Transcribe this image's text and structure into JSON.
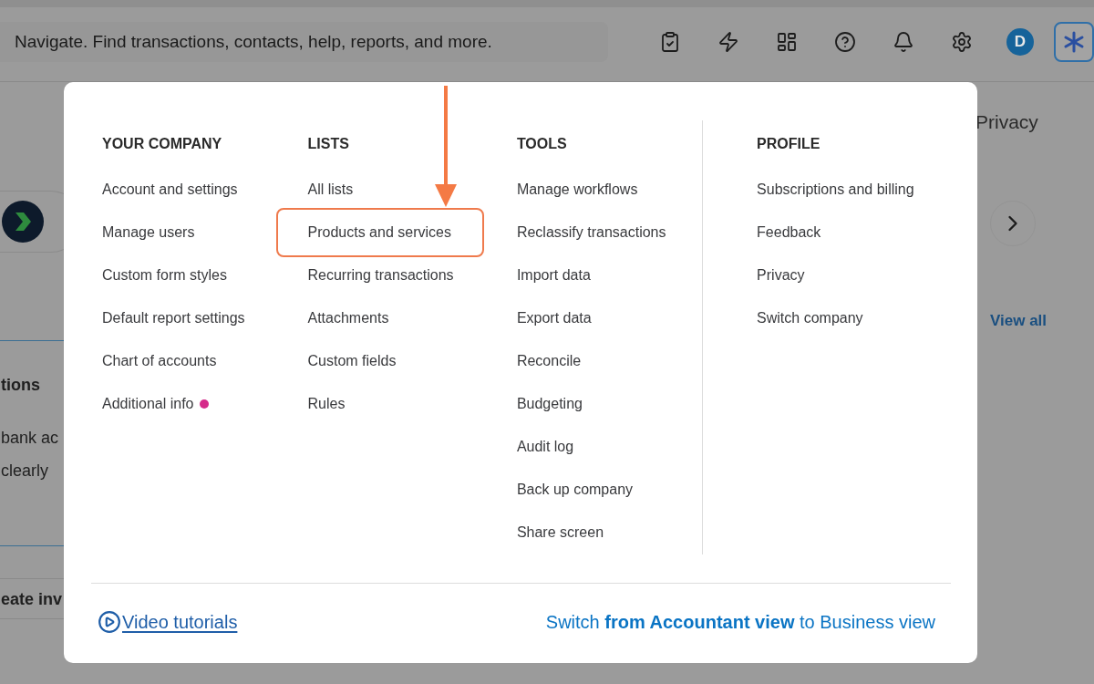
{
  "search": {
    "placeholder": "Navigate. Find transactions, contacts, help, reports, and more."
  },
  "toolbar": {
    "avatar": "D"
  },
  "background": {
    "privacy": "Privacy",
    "view_all": "View all",
    "fragments": [
      {
        "text": "tions",
        "kind": "heading"
      },
      {
        "text": "bank ac",
        "kind": "body"
      },
      {
        "text": "clearly",
        "kind": "body"
      },
      {
        "text": "eate inv",
        "kind": "action"
      }
    ]
  },
  "menu": {
    "columns": [
      {
        "heading": "YOUR COMPANY",
        "items": [
          {
            "label": "Account and settings",
            "highlighted": false,
            "dot": false
          },
          {
            "label": "Manage users",
            "highlighted": false,
            "dot": false
          },
          {
            "label": "Custom form styles",
            "highlighted": false,
            "dot": false
          },
          {
            "label": "Default report settings",
            "highlighted": false,
            "dot": false
          },
          {
            "label": "Chart of accounts",
            "highlighted": false,
            "dot": false
          },
          {
            "label": "Additional info",
            "highlighted": false,
            "dot": true
          }
        ]
      },
      {
        "heading": "LISTS",
        "items": [
          {
            "label": "All lists",
            "highlighted": false,
            "dot": false
          },
          {
            "label": "Products and services",
            "highlighted": true,
            "dot": false
          },
          {
            "label": "Recurring transactions",
            "highlighted": false,
            "dot": false
          },
          {
            "label": "Attachments",
            "highlighted": false,
            "dot": false
          },
          {
            "label": "Custom fields",
            "highlighted": false,
            "dot": false
          },
          {
            "label": "Rules",
            "highlighted": false,
            "dot": false
          }
        ]
      },
      {
        "heading": "TOOLS",
        "items": [
          {
            "label": "Manage workflows",
            "highlighted": false,
            "dot": false
          },
          {
            "label": "Reclassify transactions",
            "highlighted": false,
            "dot": false
          },
          {
            "label": "Import data",
            "highlighted": false,
            "dot": false
          },
          {
            "label": "Export data",
            "highlighted": false,
            "dot": false
          },
          {
            "label": "Reconcile",
            "highlighted": false,
            "dot": false
          },
          {
            "label": "Budgeting",
            "highlighted": false,
            "dot": false
          },
          {
            "label": "Audit log",
            "highlighted": false,
            "dot": false
          },
          {
            "label": "Back up company",
            "highlighted": false,
            "dot": false
          },
          {
            "label": "Share screen",
            "highlighted": false,
            "dot": false
          }
        ]
      },
      {
        "heading": "PROFILE",
        "items": [
          {
            "label": "Subscriptions and billing",
            "highlighted": false,
            "dot": false
          },
          {
            "label": "Feedback",
            "highlighted": false,
            "dot": false
          },
          {
            "label": "Privacy",
            "highlighted": false,
            "dot": false
          },
          {
            "label": "Switch company",
            "highlighted": false,
            "dot": false
          }
        ]
      }
    ],
    "footer": {
      "video_link": "Video tutorials",
      "switch_link": "Switch **from Accountant view** to Business view"
    }
  }
}
